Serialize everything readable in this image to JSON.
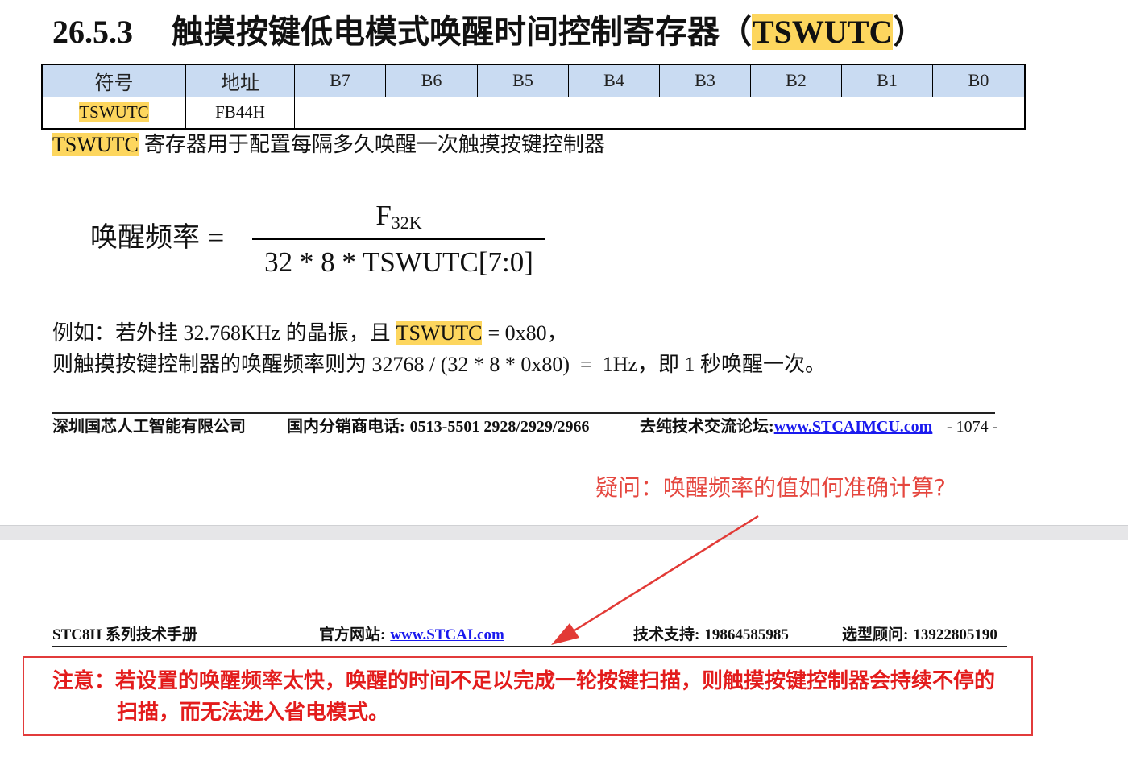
{
  "section": {
    "number": "26.5.3",
    "title_text": "触摸按键低电模式唤醒时间控制寄存器（",
    "title_register": "TSWUTC",
    "title_close": "）"
  },
  "register_table": {
    "headers": [
      "符号",
      "地址",
      "B7",
      "B6",
      "B5",
      "B4",
      "B3",
      "B2",
      "B1",
      "B0"
    ],
    "row": {
      "symbol": "TSWUTC",
      "address": "FB44H"
    }
  },
  "description": {
    "register": "TSWUTC",
    "text": "寄存器用于配置每隔多久唤醒一次触摸按键控制器"
  },
  "formula": {
    "lhs": "唤醒频率",
    "equals": "=",
    "numerator_base": "F",
    "numerator_subscript": "32K",
    "denominator": "32 * 8 * TSWUTC[7:0]"
  },
  "example": {
    "line1_prefix": "例如：若外挂 32.768KHz 的晶振，且",
    "line1_register": "TSWUTC",
    "line1_suffix": "= 0x80，",
    "line2": "则触摸按键控制器的唤醒频率则为 32768 / (32 * 8 * 0x80)  =  1Hz，即 1 秒唤醒一次。"
  },
  "page_footer": {
    "company": "深圳国芯人工智能有限公司",
    "phone_label": "国内分销商电话:",
    "phone_numbers": "0513-5501 2928/2929/2966",
    "forum_label": "去纯技术交流论坛:",
    "forum_link": "www.STCAIMCU.com",
    "page_number": "- 1074 -"
  },
  "question": "疑问：唤醒频率的值如何准确计算?",
  "next_page_header": {
    "manual_title": "STC8H 系列技术手册",
    "website_label": "官方网站:",
    "website_link": "www.STCAI.com",
    "support_label": "技术支持:",
    "support_phone": "19864585985",
    "advisor_label": "选型顾问:",
    "advisor_phone": "13922805190"
  },
  "note": {
    "line1": "注意：若设置的唤醒频率太快，唤醒的时间不足以完成一轮按键扫描，则触摸按键控制器会持续不停的",
    "line2": "扫描，而无法进入省电模式。"
  },
  "colors": {
    "highlight": "#fdd65e",
    "table_header_bg": "#c9dbf2",
    "question_red": "#e5473f",
    "note_red": "#e31c1c",
    "note_border": "#e23b3b",
    "arrow_red": "#e23a36",
    "link_blue": "#1a1aee",
    "page_gap": "#e6e6e8"
  }
}
